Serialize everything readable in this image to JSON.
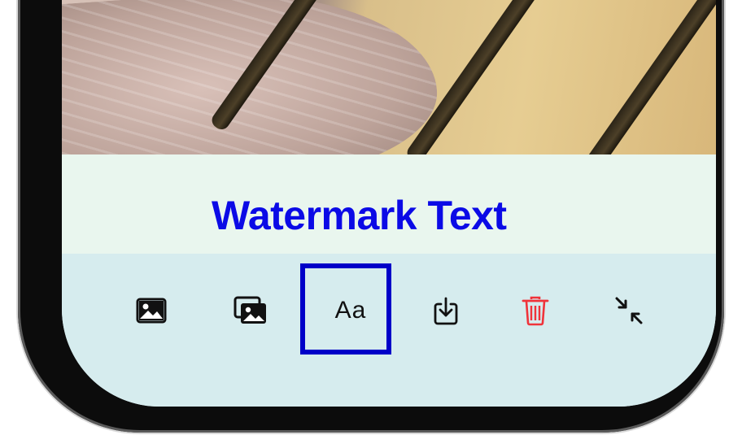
{
  "watermark": {
    "text": "Watermark Text",
    "color": "#0b0ae6"
  },
  "toolbar": {
    "tools": [
      {
        "name": "image",
        "icon": "image-icon"
      },
      {
        "name": "multiple-images",
        "icon": "photo-stack-icon"
      },
      {
        "name": "text",
        "icon": "text-icon",
        "label": "Aa",
        "selected": true
      },
      {
        "name": "download",
        "icon": "download-icon"
      },
      {
        "name": "delete",
        "icon": "trash-icon",
        "color": "#f0333a"
      },
      {
        "name": "collapse",
        "icon": "collapse-arrows-icon"
      }
    ],
    "highlight_color": "#0000c8"
  },
  "colors": {
    "watermark_panel_bg": "#e9f6ee",
    "toolbar_bg": "#d6ecee",
    "frame": "#0c0c0c"
  }
}
